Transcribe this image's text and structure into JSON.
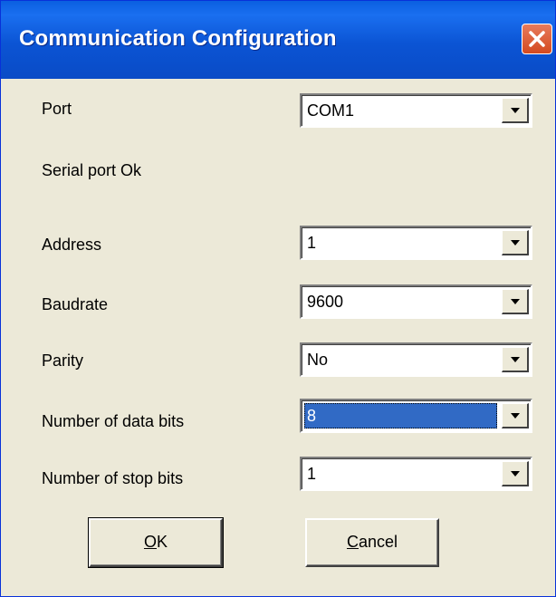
{
  "window": {
    "title": "Communication Configuration",
    "icons": {
      "close": "close-icon",
      "dropdown": "chevron-down-icon"
    },
    "colors": {
      "titlebar": "#0b54d4",
      "body": "#ece9d8",
      "close": "#d44a1f",
      "selection": "#316ac5"
    }
  },
  "port": {
    "label": "Port",
    "value": "COM1"
  },
  "status": {
    "text": "Serial port Ok"
  },
  "address": {
    "label": "Address",
    "value": "1"
  },
  "baudrate": {
    "label": "Baudrate",
    "value": "9600"
  },
  "parity": {
    "label": "Parity",
    "value": "No"
  },
  "data_bits": {
    "label": "Number of data bits",
    "value": "8"
  },
  "stop_bits": {
    "label": "Number of stop bits",
    "value": "1"
  },
  "buttons": {
    "ok": {
      "accel": "O",
      "rest": "K"
    },
    "cancel": {
      "accel": "C",
      "rest": "ancel"
    }
  }
}
